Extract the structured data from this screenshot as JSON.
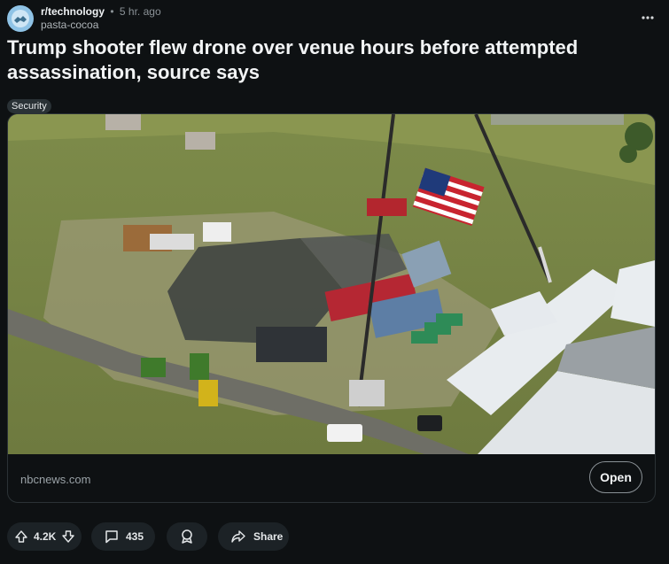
{
  "post": {
    "subreddit": "r/technology",
    "time": "5 hr. ago",
    "author": "pasta-cocoa",
    "title": "Trump shooter flew drone over venue hours before attempted assassination, source says",
    "flair": "Security",
    "link": {
      "domain": "nbcnews.com",
      "open_label": "Open"
    }
  },
  "actions": {
    "votes": "4.2K",
    "comments": "435",
    "share_label": "Share"
  },
  "icons": {
    "avatar": "subreddit-avatar-icon",
    "more": "more-options-icon",
    "upvote": "upvote-icon",
    "downvote": "downvote-icon",
    "comment": "comment-icon",
    "award": "award-icon",
    "share": "share-icon"
  },
  "colors": {
    "background": "#0e1113",
    "pill": "#1c2226",
    "flair": "#2a3236",
    "avatar": "#8fc3e6"
  }
}
